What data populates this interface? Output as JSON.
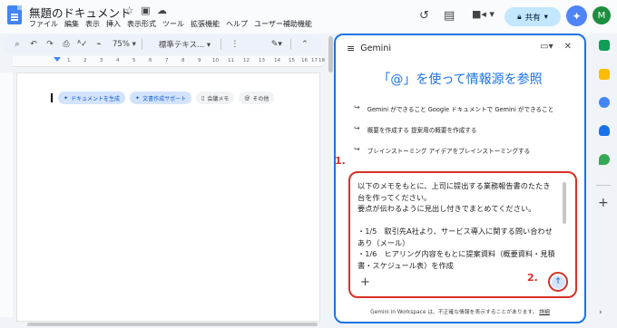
{
  "doc": {
    "title": "無題のドキュメント",
    "menu": [
      "ファイル",
      "編集",
      "表示",
      "挿入",
      "表示形式",
      "ツール",
      "拡張機能",
      "ヘルプ",
      "ユーザー補助機能"
    ],
    "share_label": "共有",
    "avatar_letter": "M"
  },
  "toolbar": {
    "zoom": "75%",
    "style": "標準テキス..."
  },
  "ruler_ticks": [
    "1",
    "2",
    "3",
    "4",
    "5",
    "6",
    "7",
    "8",
    "9",
    "10",
    "11",
    "12",
    "13",
    "14",
    "15",
    "16",
    "17",
    "18"
  ],
  "chips": [
    {
      "label": "ドキュメントを生成",
      "icon": "sparkle-icon",
      "style": "blue"
    },
    {
      "label": "文書作成サポート",
      "icon": "sparkle-icon",
      "style": "blue"
    },
    {
      "label": "会議メモ",
      "icon": "doc-icon",
      "style": "gray"
    },
    {
      "label": "その他",
      "icon": "at-icon",
      "style": "gray"
    }
  ],
  "gemini": {
    "title": "Gemini",
    "headline": "「@」を使って情報源を参照",
    "suggestions": [
      "Gemini ができること Google ドキュメントで Gemini ができること",
      "概要を作成する 提案用の概要を作成する",
      "ブレインストーミング アイデアをブレインストーミングする"
    ],
    "prompt_text": "以下のメモをもとに、上司に提出する業務報告書のたたき台を作ってください。\n要点が伝わるように見出し付きでまとめてください。\n\n・1/5　取引先A社より、サービス導入に関する問い合わせあり（メール）\n・1/6　ヒアリング内容をもとに提案資料（概要資料・見積書・スケジュール表）を作成",
    "disclaimer": "Gemini in Workspace は、不正確な情報を表示することがあります。",
    "disclaimer_link": "詳細"
  },
  "steps": {
    "one": "1.",
    "two": "2."
  },
  "colors": {
    "accent": "#1a73e8",
    "annotation": "#d93025",
    "share_bg": "#c2e7ff"
  }
}
